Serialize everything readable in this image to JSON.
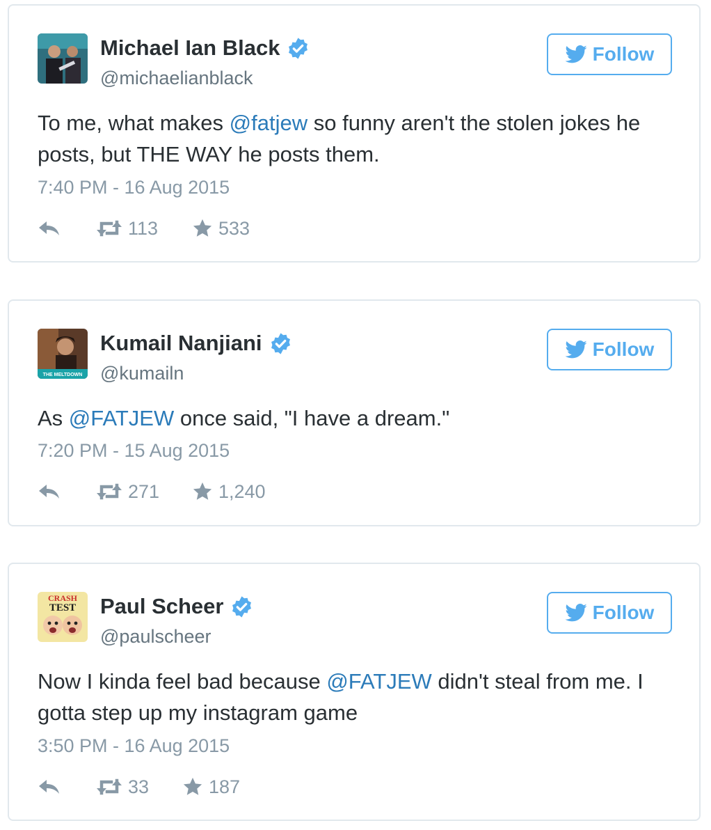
{
  "follow_label": "Follow",
  "colors": {
    "accent": "#55acee",
    "mention": "#2b7bb9",
    "verified": "#55acee",
    "meta": "#8899a6"
  },
  "tweets": [
    {
      "name": "Michael Ian Black",
      "handle": "@michaelianblack",
      "text_parts": [
        "To me, what makes ",
        "@fatjew",
        " so funny aren't the stolen jokes he posts, but THE WAY he posts them."
      ],
      "date": "7:40 PM - 16 Aug 2015",
      "retweets": "113",
      "likes": "533"
    },
    {
      "name": "Kumail Nanjiani",
      "handle": "@kumailn",
      "text_parts": [
        "As ",
        "@FATJEW",
        " once said, \"I have a dream.\""
      ],
      "date": "7:20 PM - 15 Aug 2015",
      "retweets": "271",
      "likes": "1,240",
      "avatar_text": "THE MELTDOWN"
    },
    {
      "name": "Paul Scheer",
      "handle": "@paulscheer",
      "text_parts": [
        "Now I kinda feel bad because ",
        "@FATJEW",
        " didn't steal from me. I gotta step up my instagram game"
      ],
      "date": "3:50 PM - 16 Aug 2015",
      "retweets": "33",
      "likes": "187",
      "avatar_text_top": "CRASH",
      "avatar_text_bottom": "TEST"
    }
  ]
}
